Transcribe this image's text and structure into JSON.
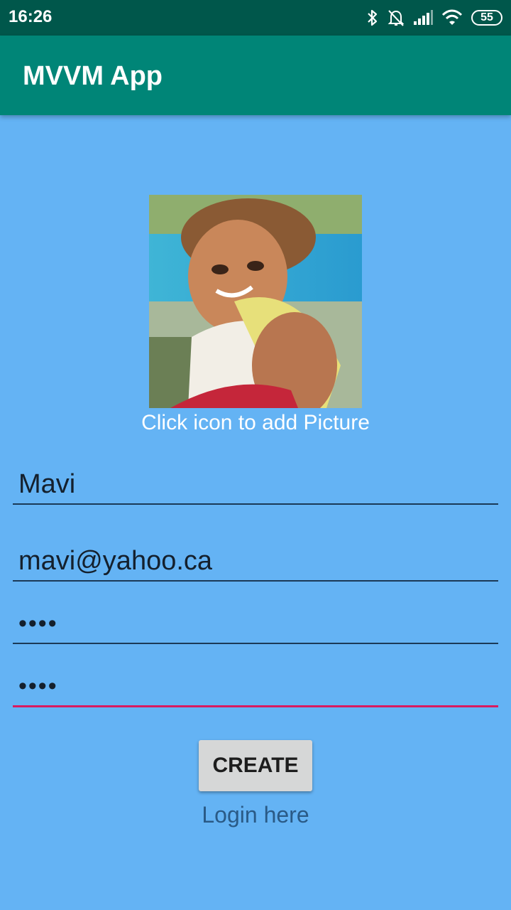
{
  "status_bar": {
    "time": "16:26",
    "battery": "55",
    "icons": [
      "bluetooth-icon",
      "bell-off-icon",
      "signal-icon",
      "wifi-icon",
      "battery-icon"
    ]
  },
  "app_bar": {
    "title": "MVVM App"
  },
  "avatar": {
    "icon": "profile-photo"
  },
  "add_picture_label": "Click icon to add Picture",
  "form": {
    "name": "Mavi",
    "email": "mavi@yahoo.ca",
    "password": "••••",
    "confirm_password": "••••"
  },
  "create_button": "CREATE",
  "login_link": "Login here",
  "colors": {
    "background": "#64b3f4",
    "app_bar": "#008577",
    "status_bar": "#00574b",
    "focus_underline": "#d81b60"
  }
}
